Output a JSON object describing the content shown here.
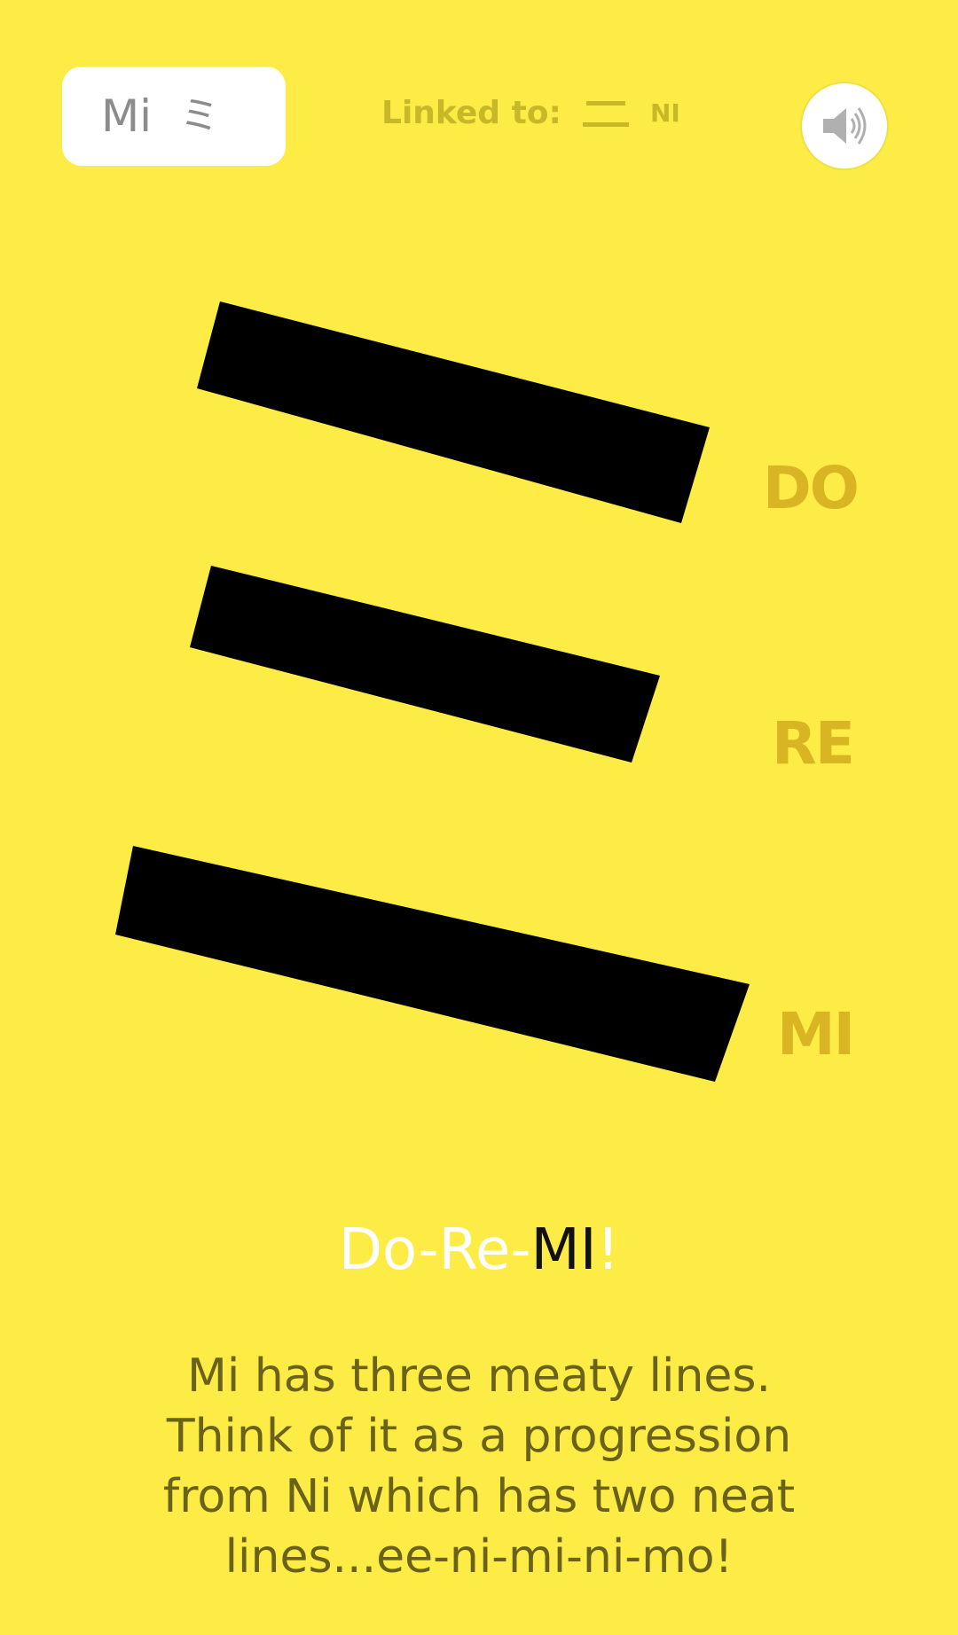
{
  "top_chip": {
    "label": "Mi",
    "glyph": "ミ"
  },
  "linked": {
    "label": "Linked to:",
    "glyph": "ニ",
    "name": "NI"
  },
  "sound_button": {
    "icon": "speaker-icon"
  },
  "strokes": {
    "labels": [
      "DO",
      "RE",
      "MI"
    ]
  },
  "title": {
    "part1": "Do-Re-",
    "part2": "MI",
    "part3": "!"
  },
  "description": {
    "lines": [
      "Mi has three meaty lines.",
      "Think of it as a progression",
      "from Ni which has two neat",
      "lines...ee-ni-mi-ni-mo!"
    ]
  },
  "colors": {
    "background": "#fcec45",
    "stroke": "#000000",
    "label_accent": "#d9b524",
    "text_dark": "#6a621a"
  }
}
